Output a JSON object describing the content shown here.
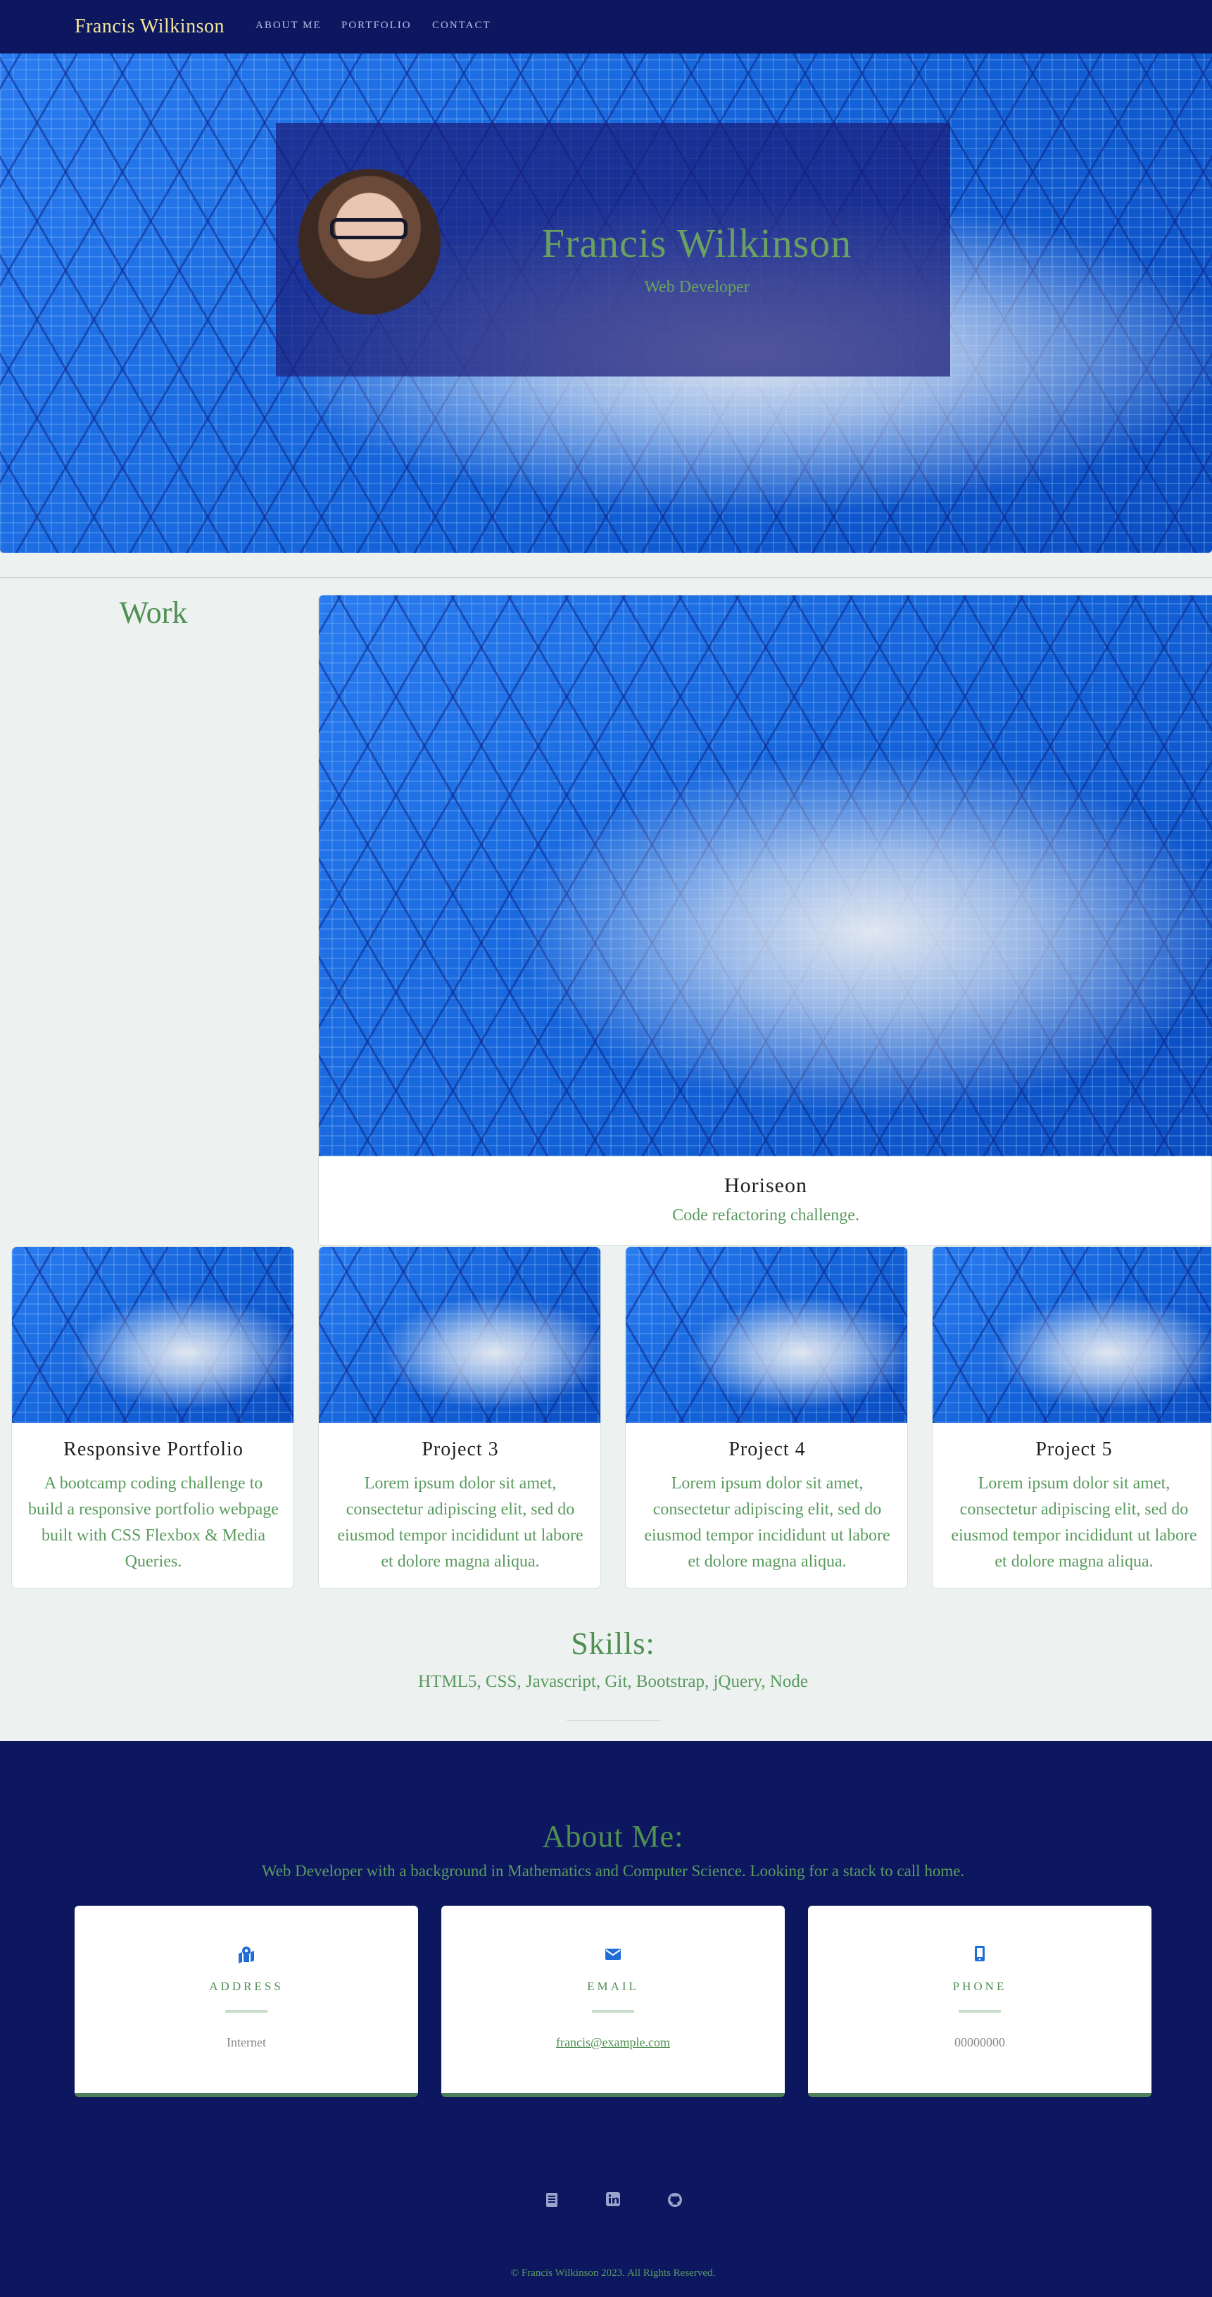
{
  "nav": {
    "brand": "Francis Wilkinson",
    "links": [
      "ABOUT ME",
      "PORTFOLIO",
      "CONTACT"
    ]
  },
  "hero": {
    "name": "Francis Wilkinson",
    "subtitle": "Web Developer"
  },
  "work": {
    "title": "Work",
    "featured": {
      "title": "Horiseon",
      "desc": "Code refactoring challenge."
    },
    "projects": [
      {
        "title": "Responsive Portfolio",
        "desc": "A bootcamp coding challenge to build a responsive portfolio webpage built with CSS Flexbox & Media Queries."
      },
      {
        "title": "Project 3",
        "desc": "Lorem ipsum dolor sit amet, consectetur adipiscing elit, sed do eiusmod tempor incididunt ut labore et dolore magna aliqua."
      },
      {
        "title": "Project 4",
        "desc": "Lorem ipsum dolor sit amet, consectetur adipiscing elit, sed do eiusmod tempor incididunt ut labore et dolore magna aliqua."
      },
      {
        "title": "Project 5",
        "desc": "Lorem ipsum dolor sit amet, consectetur adipiscing elit, sed do eiusmod tempor incididunt ut labore et dolore magna aliqua."
      }
    ]
  },
  "skills": {
    "title": "Skills:",
    "list": "HTML5, CSS, Javascript, Git, Bootstrap, jQuery, Node"
  },
  "about": {
    "title": "About Me:",
    "desc": "Web Developer with a background in Mathematics and Computer Science. Looking for a stack to call home.",
    "cards": [
      {
        "icon": "map-icon",
        "label": "ADDRESS",
        "value": "Internet"
      },
      {
        "icon": "envelope-icon",
        "label": "EMAIL",
        "value": "francis@example.com"
      },
      {
        "icon": "mobile-phone-icon",
        "label": "PHONE",
        "value": "00000000"
      }
    ]
  },
  "social": [
    "resume-icon",
    "linkedin-icon",
    "github-icon"
  ],
  "footer": "© Francis Wilkinson 2023. All Rights Reserved.",
  "colors": {
    "nav_bg": "#0c1760",
    "accent_green": "#4f8f52",
    "icon_blue": "#1f6ed8"
  }
}
